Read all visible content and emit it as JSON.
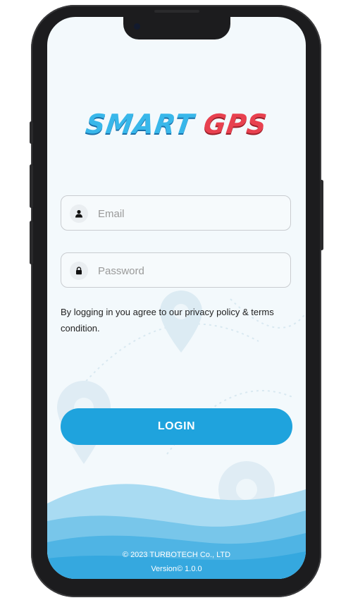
{
  "app": {
    "logo_word1": "SMART",
    "logo_word2": "GPS"
  },
  "form": {
    "email_placeholder": "Email",
    "password_placeholder": "Password",
    "email_icon": "user-icon",
    "password_icon": "lock-icon"
  },
  "terms_text": "By logging in you agree to our privacy policy & terms condition.",
  "login_label": "LOGIN",
  "footer": {
    "copyright": "© 2023 TURBOTECH Co., LTD",
    "version": "Version© 1.0.0"
  },
  "colors": {
    "primary": "#1fa3dd",
    "logo_blue": "#38b7ea",
    "logo_red": "#e8414f",
    "background": "#f3f9fc"
  }
}
